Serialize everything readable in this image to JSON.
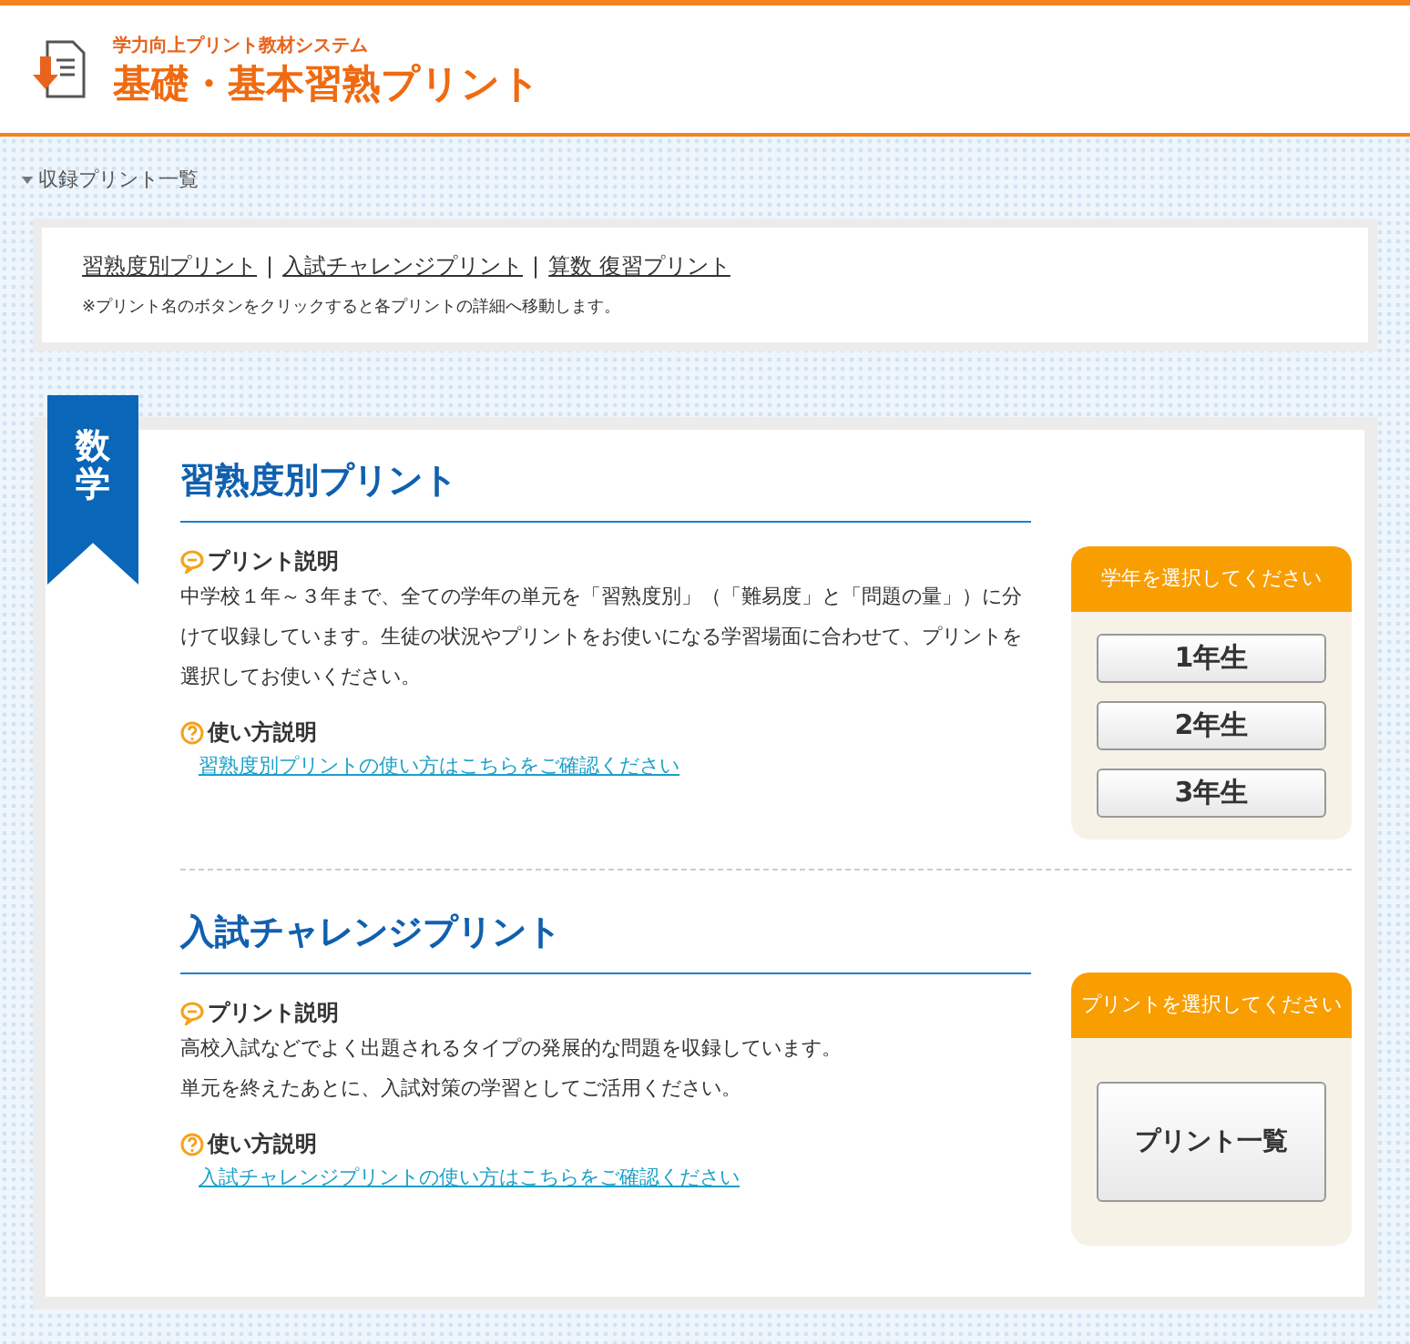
{
  "header": {
    "subtitle": "学力向上プリント教材システム",
    "title": "基礎・基本習熟プリント"
  },
  "breadcrumb": "収録プリント一覧",
  "nav": {
    "links": [
      "習熟度別プリント",
      "入試チャレンジプリント",
      "算数 復習プリント"
    ],
    "separator": "|",
    "note": "※プリント名のボタンをクリックすると各プリントの詳細へ移動します。"
  },
  "ribbon": "数学",
  "sections": [
    {
      "title": "習熟度別プリント",
      "description_label": "プリント説明",
      "description": [
        "中学校１年～３年まで、全ての学年の単元を「習熟度別」（「難易度」と「問題の量」）に分けて収録しています。生徒の状況やプリントをお使いになる学習場面に合わせて、プリントを選択してお使いください。"
      ],
      "usage_label": "使い方説明",
      "usage_link": "習熟度別プリントの使い方はこちらをご確認ください",
      "panel": {
        "kind": "grades",
        "title": "学年を選択してください",
        "buttons": [
          "1年生",
          "2年生",
          "3年生"
        ]
      }
    },
    {
      "title": "入試チャレンジプリント",
      "description_label": "プリント説明",
      "description": [
        "高校入試などでよく出題されるタイプの発展的な問題を収録しています。",
        "単元を終えたあとに、入試対策の学習としてご活用ください。"
      ],
      "usage_label": "使い方説明",
      "usage_link": "入試チャレンジプリントの使い方はこちらをご確認ください",
      "panel": {
        "kind": "list",
        "title": "プリントを選択してください",
        "buttons": [
          "プリント一覧"
        ]
      }
    }
  ]
}
